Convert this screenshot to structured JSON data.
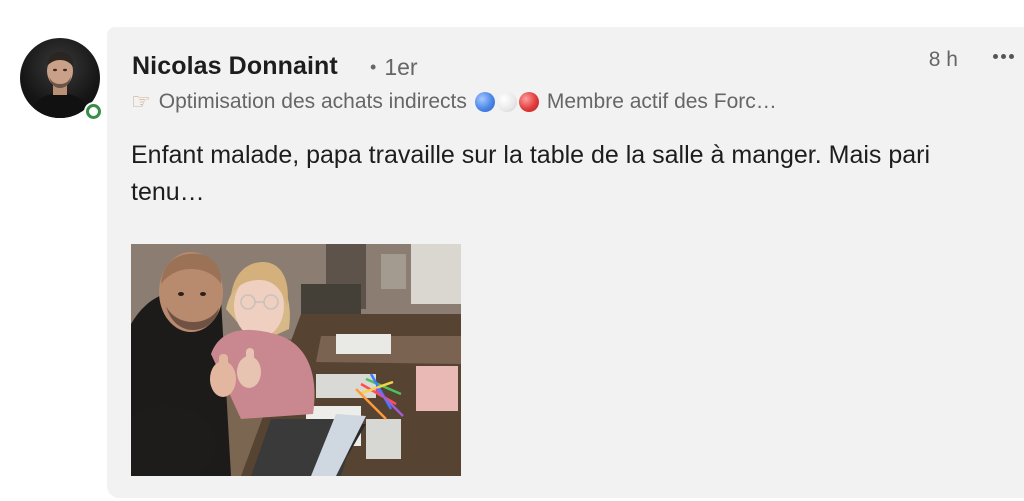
{
  "author": {
    "name": "Nicolas Donnaint",
    "degree": "1er",
    "degree_separator": "•",
    "headline_prefix": "Optimisation des achats indirects",
    "headline_suffix": "Membre actif des Forc…",
    "presence_status": "online",
    "presence_color": "#378d4a"
  },
  "post": {
    "time": "8 h",
    "text": "Enfant malade, papa travaille sur la table de la salle à manger. Mais pari tenu…",
    "image_alt": "Selfie d'un père et sa fille levant le pouce devant une table de salle à manger avec ordinateur, feutres et papiers"
  },
  "icons": {
    "pointing_hand": "pointing-hand-icon",
    "more": "more-options-icon",
    "circles": [
      "blue-circle",
      "white-circle",
      "red-circle"
    ]
  },
  "colors": {
    "card_background": "#f2f2f2",
    "secondary_text": "#666666",
    "primary_text": "#1d1d1d"
  }
}
